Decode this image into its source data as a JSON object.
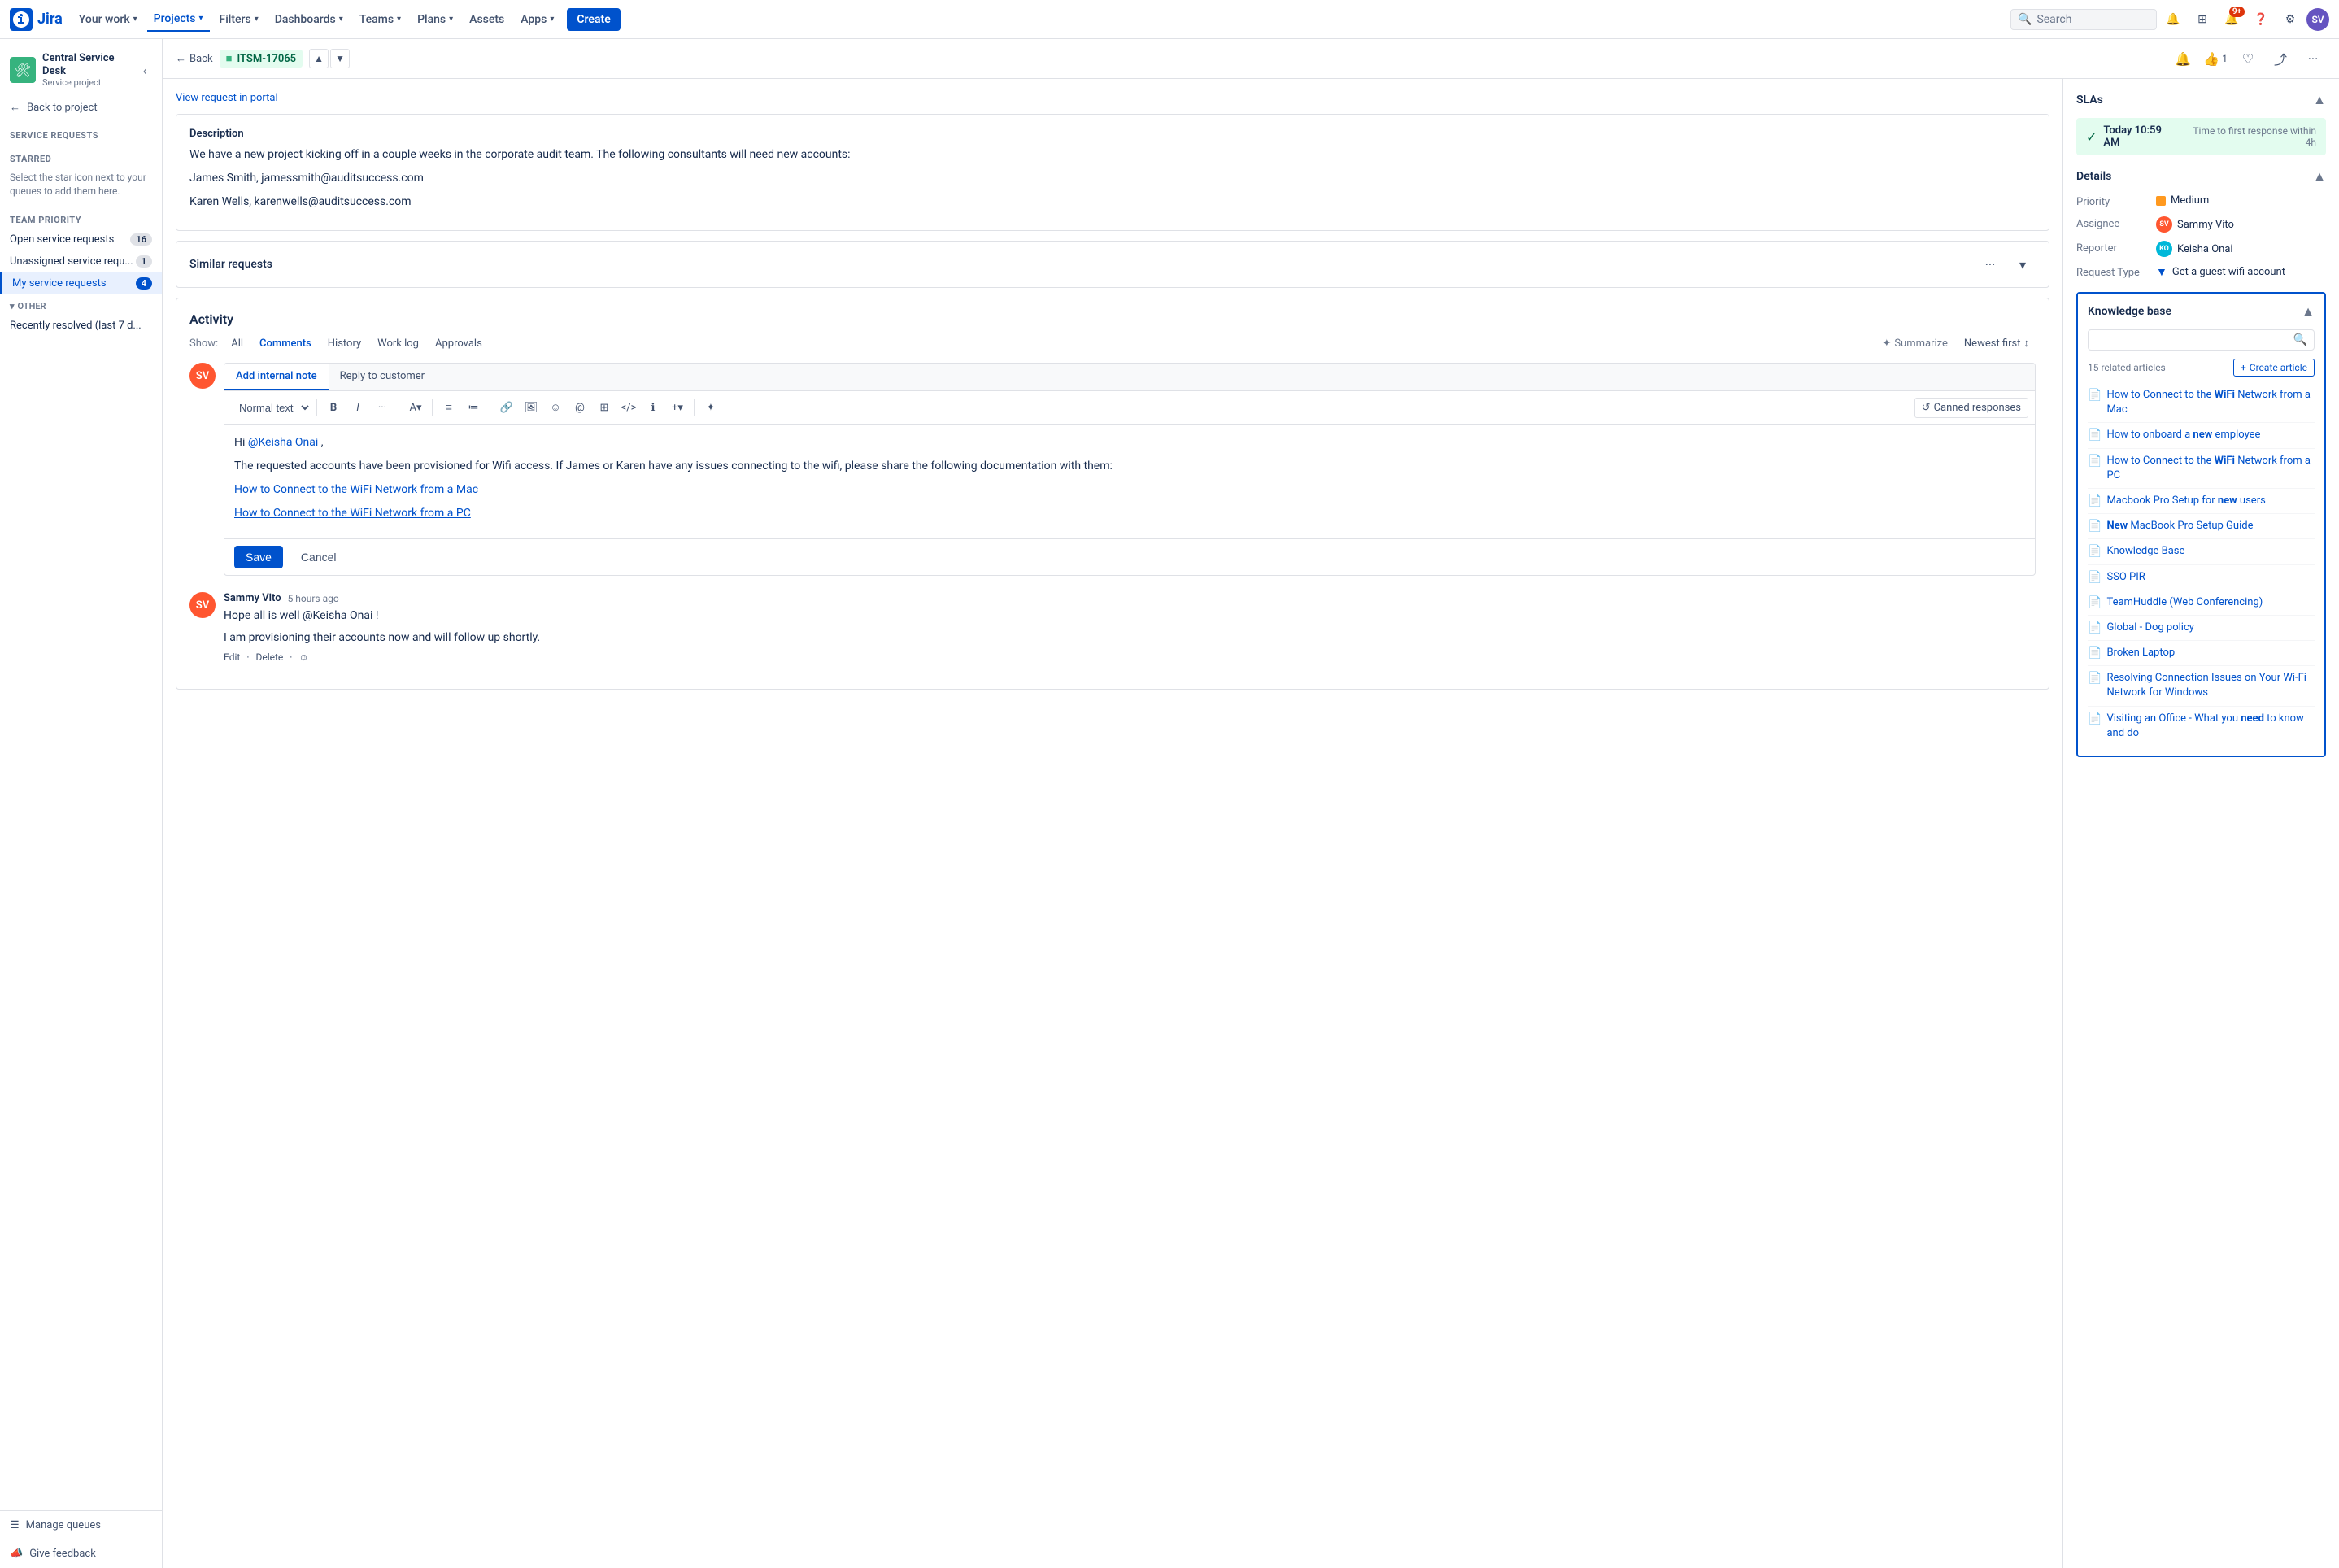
{
  "app": {
    "name": "Jira",
    "logo_text": "Jira"
  },
  "topnav": {
    "your_work": "Your work",
    "projects": "Projects",
    "filters": "Filters",
    "dashboards": "Dashboards",
    "teams": "Teams",
    "plans": "Plans",
    "assets": "Assets",
    "apps": "Apps",
    "create": "Create",
    "search_placeholder": "Search",
    "notification_count": "9+"
  },
  "sidebar": {
    "project_name": "Central Service Desk",
    "project_type": "Service project",
    "back_to_project": "Back to project",
    "service_requests": "Service requests",
    "starred_label": "STARRED",
    "starred_hint": "Select the star icon next to your queues to add them here.",
    "team_priority": "TEAM PRIORITY",
    "queue_items": [
      {
        "label": "Open service requests",
        "count": "16",
        "active": false
      },
      {
        "label": "Unassigned service requ...",
        "count": "1",
        "active": false
      },
      {
        "label": "My service requests",
        "count": "4",
        "active": true
      }
    ],
    "other_label": "OTHER",
    "other_items": [
      {
        "label": "Recently resolved (last 7 d...",
        "active": false
      }
    ],
    "manage_queues": "Manage queues",
    "give_feedback": "Give feedback"
  },
  "breadcrumb": {
    "back": "Back",
    "issue_id": "ITSM-17065"
  },
  "description": {
    "label": "Description",
    "view_portal": "View request in portal",
    "body": "We have a new project kicking off in a couple weeks in the corporate audit team. The following consultants will need new accounts:",
    "contacts": [
      "James Smith, jamessmith@auditsuccess.com",
      "Karen Wells, karenwells@auditsuccess.com"
    ]
  },
  "similar_requests": {
    "title": "Similar requests"
  },
  "activity": {
    "title": "Activity",
    "show_label": "Show:",
    "tabs": [
      "All",
      "Comments",
      "History",
      "Work log",
      "Approvals"
    ],
    "active_tab": "Comments",
    "summarize": "Summarize",
    "newest_first": "Newest first"
  },
  "editor": {
    "tab_internal": "Add internal note",
    "tab_reply": "Reply to customer",
    "toolbar": {
      "text_style": "Normal text",
      "bold": "B",
      "italic": "I",
      "more": "···",
      "canned_responses": "Canned responses"
    },
    "content": {
      "greeting": "Hi @Keisha Onai ,",
      "body": "The requested accounts have been provisioned for Wifi access. If James or Karen have any issues connecting to the wifi, please share the following documentation with them:",
      "link1": "How to Connect to the WiFi Network from a Mac",
      "link2": "How to Connect to the WiFi Network from a PC"
    },
    "save_btn": "Save",
    "cancel_btn": "Cancel"
  },
  "comment": {
    "author": "Sammy Vito",
    "time": "5 hours ago",
    "text1": "Hope all is well @Keisha Onai !",
    "text2": "I am provisioning their accounts now and will follow up shortly.",
    "action_edit": "Edit",
    "action_delete": "Delete"
  },
  "sla": {
    "title": "SLAs",
    "time": "Today 10:59 AM",
    "label": "Time to first response within 4h"
  },
  "details": {
    "title": "Details",
    "priority_label": "Priority",
    "priority_value": "Medium",
    "assignee_label": "Assignee",
    "assignee_value": "Sammy Vito",
    "reporter_label": "Reporter",
    "reporter_value": "Keisha Onai",
    "request_type_label": "Request Type",
    "request_type_value": "Get a guest wifi account"
  },
  "knowledge_base": {
    "title": "Knowledge base",
    "search_placeholder": "",
    "related_count": "15 related articles",
    "create_article": "Create article",
    "articles": [
      {
        "title": "How to Connect to the ",
        "bold": "WiFi",
        "rest": " Network from a Mac"
      },
      {
        "title": "How to onboard a ",
        "bold": "new",
        "rest": " employee"
      },
      {
        "title": "How to Connect to the ",
        "bold": "WiFi",
        "rest": " Network from a PC"
      },
      {
        "title": "Macbook Pro Setup for ",
        "bold": "new",
        "rest": " users"
      },
      {
        "title": "",
        "bold": "New",
        "rest": " MacBook Pro Setup Guide"
      },
      {
        "title": "Knowledge Base",
        "bold": "",
        "rest": ""
      },
      {
        "title": "SSO PIR",
        "bold": "",
        "rest": ""
      },
      {
        "title": "TeamHuddle (Web Conferencing)",
        "bold": "",
        "rest": ""
      },
      {
        "title": "Global - Dog policy",
        "bold": "",
        "rest": ""
      },
      {
        "title": "Broken Laptop",
        "bold": "",
        "rest": ""
      },
      {
        "title": "Resolving Connection Issues on Your Wi-Fi Network for Windows",
        "bold": "",
        "rest": ""
      },
      {
        "title": "Visiting an Office - What you ",
        "bold": "need",
        "rest": " to know and do"
      }
    ]
  }
}
